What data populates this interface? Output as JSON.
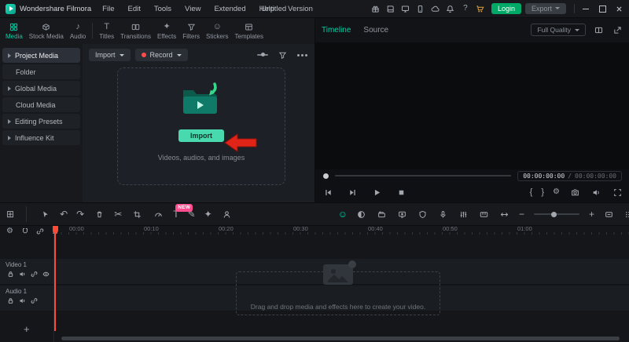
{
  "icons": {
    "grid": "⊞",
    "undo": "↶",
    "redo": "↷",
    "scissors": "✂",
    "gear": "⚙",
    "note": "♪",
    "smiley": "☺",
    "pencil": "✎",
    "sparkle": "✦",
    "text_tool": "T",
    "mark_in": "{",
    "mark_out": "}",
    "zoom_out": "−",
    "zoom_in": "+",
    "add": "+",
    "help": "?"
  },
  "titlebar": {
    "app_name": "Wondershare Filmora",
    "menus": [
      "File",
      "Edit",
      "Tools",
      "View",
      "Extended",
      "Help",
      "Version"
    ],
    "project_title": "Untitled",
    "login_label": "Login",
    "export_label": "Export"
  },
  "library": {
    "tabs": [
      {
        "label": "Media"
      },
      {
        "label": "Stock Media"
      },
      {
        "label": "Audio"
      },
      {
        "label": "Titles"
      },
      {
        "label": "Transitions"
      },
      {
        "label": "Effects"
      },
      {
        "label": "Filters"
      },
      {
        "label": "Stickers"
      },
      {
        "label": "Templates"
      }
    ],
    "sidebar": [
      {
        "label": "Project Media"
      },
      {
        "label": "Folder"
      },
      {
        "label": "Global Media"
      },
      {
        "label": "Cloud Media"
      },
      {
        "label": "Editing Presets"
      },
      {
        "label": "Influence Kit"
      }
    ],
    "toolbar": {
      "import_label": "Import",
      "record_label": "Record"
    },
    "dropzone": {
      "import_label": "Import",
      "hint": "Videos, audios, and images"
    }
  },
  "preview": {
    "tabs": [
      {
        "label": "Timeline"
      },
      {
        "label": "Source"
      }
    ],
    "quality_label": "Full Quality",
    "current_time": "00:00:00:00",
    "time_separator": "/",
    "total_time": "00:00:00:00"
  },
  "timeline": {
    "new_badge": "NEW",
    "ruler": [
      "00:00",
      "00:10",
      "00:20",
      "00:30",
      "00:40",
      "00:50",
      "01:00"
    ],
    "tracks": [
      {
        "label": "Video 1"
      },
      {
        "label": "Audio 1"
      }
    ],
    "dropzone_hint": "Drag and drop media and effects here to create your video."
  },
  "colors": {
    "accent": "#00cfa6",
    "record_red": "#ff4b4b",
    "badge_pink": "#ff4d8d",
    "arrow_red": "#e02418",
    "login_green": "#00a966"
  }
}
